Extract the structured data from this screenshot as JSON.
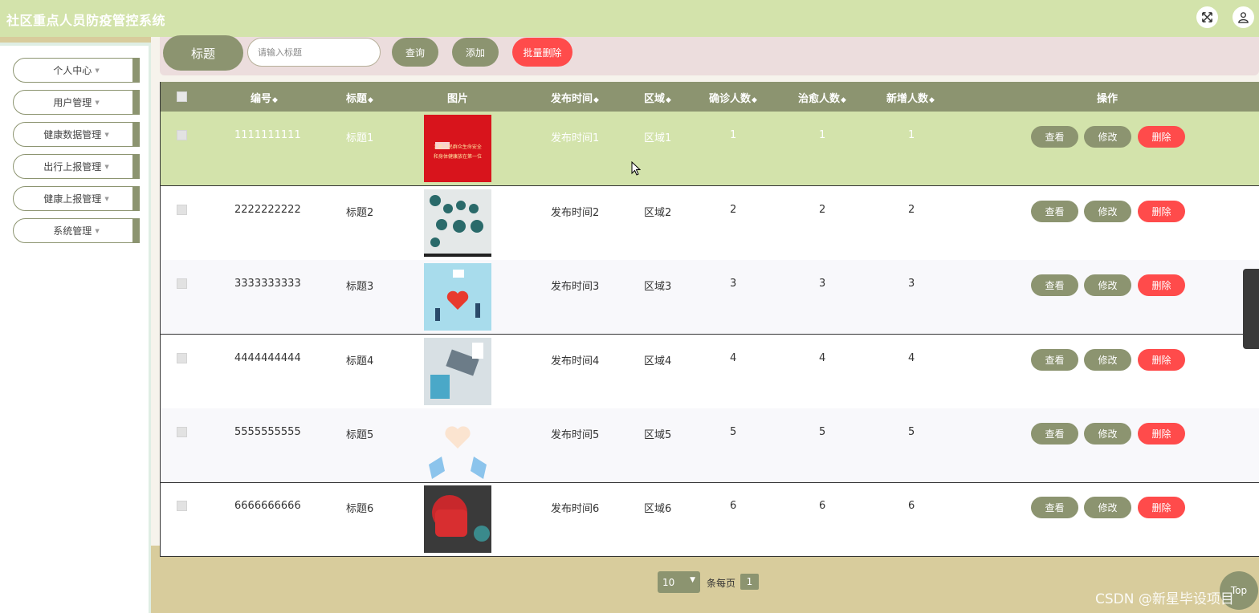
{
  "header": {
    "title": "社区重点人员防疫管控系统"
  },
  "sidebar": {
    "items": [
      {
        "label": "个人中心"
      },
      {
        "label": "用户管理"
      },
      {
        "label": "健康数据管理"
      },
      {
        "label": "出行上报管理"
      },
      {
        "label": "健康上报管理"
      },
      {
        "label": "系统管理"
      }
    ]
  },
  "search": {
    "label": "标题",
    "placeholder": "请输入标题",
    "query_btn": "查询",
    "add_btn": "添加",
    "batch_delete_btn": "批量删除"
  },
  "table": {
    "headers": {
      "id": "编号",
      "title": "标题",
      "image": "图片",
      "publish_time": "发布时间",
      "region": "区域",
      "confirmed": "确诊人数",
      "cured": "治愈人数",
      "new_cases": "新增人数",
      "actions": "操作"
    },
    "sort_glyph": "◆",
    "rows": [
      {
        "id": "1111111111",
        "title": "标题1",
        "publish_time": "发布时间1",
        "region": "区域1",
        "confirmed": "1",
        "cured": "1",
        "new_cases": "1",
        "image_text_1": "1.把人民群众生命安全",
        "image_text_2": "和身体健康放在第一位"
      },
      {
        "id": "2222222222",
        "title": "标题2",
        "publish_time": "发布时间2",
        "region": "区域2",
        "confirmed": "2",
        "cured": "2",
        "new_cases": "2"
      },
      {
        "id": "3333333333",
        "title": "标题3",
        "publish_time": "发布时间3",
        "region": "区域3",
        "confirmed": "3",
        "cured": "3",
        "new_cases": "3"
      },
      {
        "id": "4444444444",
        "title": "标题4",
        "publish_time": "发布时间4",
        "region": "区域4",
        "confirmed": "4",
        "cured": "4",
        "new_cases": "4"
      },
      {
        "id": "5555555555",
        "title": "标题5",
        "publish_time": "发布时间5",
        "region": "区域5",
        "confirmed": "5",
        "cured": "5",
        "new_cases": "5"
      },
      {
        "id": "6666666666",
        "title": "标题6",
        "publish_time": "发布时间6",
        "region": "区域6",
        "confirmed": "6",
        "cured": "6",
        "new_cases": "6"
      }
    ],
    "actions": {
      "view": "查看",
      "edit": "修改",
      "delete": "删除"
    }
  },
  "pagination": {
    "page_size": "10",
    "per_page_label": "条每页",
    "current_page": "1"
  },
  "top_button": "Top",
  "watermark": "CSDN @新星毕设项目",
  "colors": {
    "header": "#d3e3ab",
    "accent": "#8c9470",
    "danger": "#ff4b4b",
    "search_bar": "#ecdddd"
  }
}
